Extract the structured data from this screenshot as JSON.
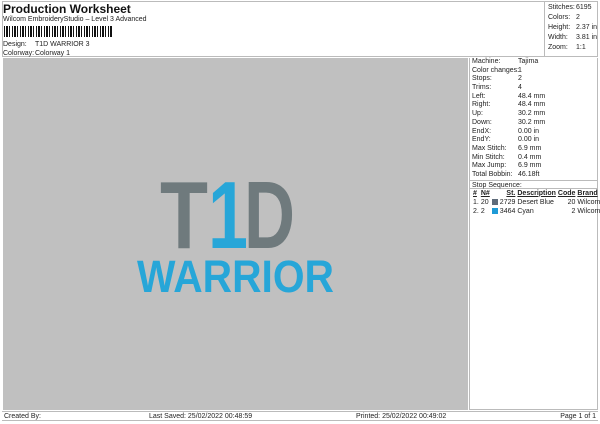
{
  "header": {
    "title": "Production Worksheet",
    "subtitle": "Wilcom EmbroideryStudio – Level 3 Advanced",
    "design_label": "Design:",
    "design_value": "T1D WARRIOR 3",
    "colorway_label": "Colorway:",
    "colorway_value": "Colorway 1"
  },
  "stats": [
    {
      "k": "Stitches:",
      "v": "6195"
    },
    {
      "k": "Colors:",
      "v": "2"
    },
    {
      "k": "Height:",
      "v": "2.37 in"
    },
    {
      "k": "Width:",
      "v": "3.81 in"
    },
    {
      "k": "Zoom:",
      "v": "1:1"
    }
  ],
  "design": {
    "line1": [
      "T",
      "1",
      "D"
    ],
    "line2": "WARRIOR",
    "colors": {
      "grey": "#6f7a7d",
      "cyan": "#27a6d8"
    }
  },
  "panel": {
    "rows": [
      {
        "k": "Machine:",
        "v": "Tajima"
      },
      {
        "k": "Color changes:",
        "v": "1"
      },
      {
        "k": "Stops:",
        "v": "2"
      },
      {
        "k": "Trims:",
        "v": "4"
      },
      {
        "k": "Left:",
        "v": "48.4 mm"
      },
      {
        "k": "Right:",
        "v": "48.4 mm"
      },
      {
        "k": "Up:",
        "v": "30.2 mm"
      },
      {
        "k": "Down:",
        "v": "30.2 mm"
      },
      {
        "k": "EndX:",
        "v": "0.00 in"
      },
      {
        "k": "EndY:",
        "v": "0.00 in"
      },
      {
        "k": "Max Stitch:",
        "v": "6.9 mm"
      },
      {
        "k": "Min Stitch:",
        "v": "0.4 mm"
      },
      {
        "k": "Max Jump:",
        "v": "6.9 mm"
      },
      {
        "k": "Total Bobbin:",
        "v": "46.18ft"
      }
    ],
    "stop_sequence_label": "Stop Sequence:",
    "columns": [
      "#",
      "N#",
      "St.",
      "Description",
      "Code",
      "Brand"
    ],
    "stops": [
      {
        "num": "1.",
        "n": "20",
        "color": "#5f6b7a",
        "st": "2729",
        "desc": "Desert Blue",
        "code": "20",
        "brand": "Wilcom"
      },
      {
        "num": "2.",
        "n": "2",
        "color": "#1e9ad6",
        "st": "3464",
        "desc": "Cyan",
        "code": "2",
        "brand": "Wilcom"
      }
    ]
  },
  "footer": {
    "created": "Created By:",
    "saved": "Last Saved: 25/02/2022 00:48:59",
    "printed": "Printed: 25/02/2022 00:49:02",
    "page": "Page 1 of 1"
  }
}
